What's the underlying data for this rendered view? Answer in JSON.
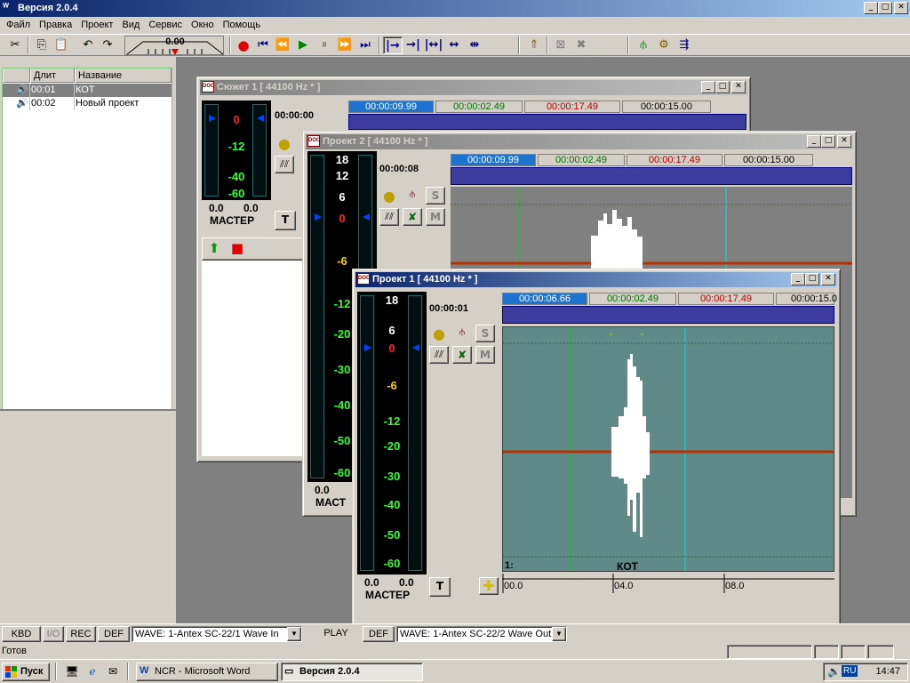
{
  "app": {
    "title": "Версия 2.0.4"
  },
  "menu": [
    "Файл",
    "Правка",
    "Проект",
    "Вид",
    "Сервис",
    "Окно",
    "Помощь"
  ],
  "toolbar": {
    "zoom_value": "0.00"
  },
  "list": {
    "headers": [
      "Длит",
      "Название"
    ],
    "rows": [
      {
        "duration": "00:01",
        "name": "КОТ",
        "selected": true
      },
      {
        "duration": "00:02",
        "name": "Новый проект",
        "selected": false
      }
    ]
  },
  "windows": {
    "w1": {
      "title": "Сюжет 1 [ 44100 Hz * ]",
      "timecode": "00:00:00",
      "ruler": [
        "00:00:09.99",
        "00:00:02.49",
        "00:00:17.49",
        "00:00:15.00"
      ],
      "meter_labels": [
        "0",
        "-12",
        "-40",
        "-60"
      ],
      "levels": [
        "0.0",
        "0.0"
      ],
      "master": "МАСТЕР"
    },
    "w2": {
      "title": "Проект 2 [ 44100 Hz * ]",
      "timecode": "00:00:08",
      "ruler": [
        "00:00:09.99",
        "00:00:02.49",
        "00:00:17.49",
        "00:00:15.00"
      ],
      "meter_labels": [
        "18",
        "12",
        "6",
        "0",
        "-6",
        "-12",
        "-20",
        "-30",
        "-40",
        "-50",
        "-60"
      ],
      "levels": [
        "0.0",
        ""
      ],
      "master": "МАСТ",
      "s_label": "S",
      "m_label": "M"
    },
    "w3": {
      "title": "Проект 1 [ 44100 Hz * ]",
      "timecode": "00:00:01",
      "ruler": [
        "00:00:06.66",
        "00:00:02.49",
        "00:00:17.49",
        "00:00:15.0"
      ],
      "meter_labels": [
        "18",
        "6",
        "0",
        "-6",
        "-12",
        "-20",
        "-30",
        "-40",
        "-50",
        "-60"
      ],
      "levels": [
        "0.0",
        "0.0"
      ],
      "master": "МАСТЕР",
      "s_label": "S",
      "m_label": "M",
      "track_number": "1:",
      "clip_name": "КОТ",
      "time_ticks": [
        "00.0",
        "04.0",
        "08.0"
      ]
    }
  },
  "bottom": {
    "kbd": "KBD",
    "io": "I/O",
    "rec": "REC",
    "def1": "DEF",
    "wave_in": "WAVE: 1-Antex SC-22/1 Wave In",
    "play": "PLAY",
    "def2": "DEF",
    "wave_out": "WAVE: 1-Antex SC-22/2 Wave Out"
  },
  "status": {
    "text": "Готов"
  },
  "taskbar": {
    "start": "Пуск",
    "tasks": [
      "NCR - Microsoft Word",
      "Версия 2.0.4"
    ],
    "lang": "RU",
    "time": "14:47"
  },
  "colors": {
    "title_active": "#0a246a",
    "meter_green": "#33ff33",
    "meter_red": "#ff2020",
    "track_bg": "#5f8a88",
    "wave": "#ffffff",
    "red_line": "#b83000"
  }
}
